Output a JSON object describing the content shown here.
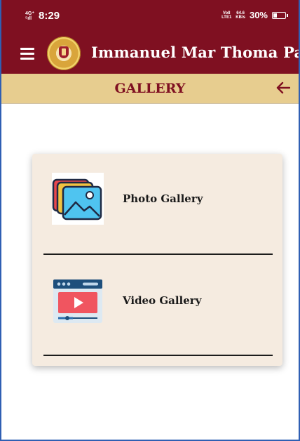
{
  "status_bar": {
    "network_top": "4G⁺",
    "network_bottom": "⁵ıll",
    "time": "8:29",
    "volte_top": "Vo8",
    "volte_bottom": "LTE1",
    "speed_top": "64.6",
    "speed_bottom": "KB/s",
    "battery": "30%",
    "battery_level": 0.3
  },
  "app_bar": {
    "title": "Immanuel Mar Thoma Parish"
  },
  "sub_header": {
    "title": "GALLERY"
  },
  "gallery": {
    "items": [
      {
        "label": "Photo Gallery",
        "icon": "photo-stack-icon"
      },
      {
        "label": "Video Gallery",
        "icon": "video-player-icon"
      }
    ]
  },
  "colors": {
    "primary": "#7f1021",
    "header_band": "#e7cd8f",
    "card_bg": "#f5ebe0"
  }
}
